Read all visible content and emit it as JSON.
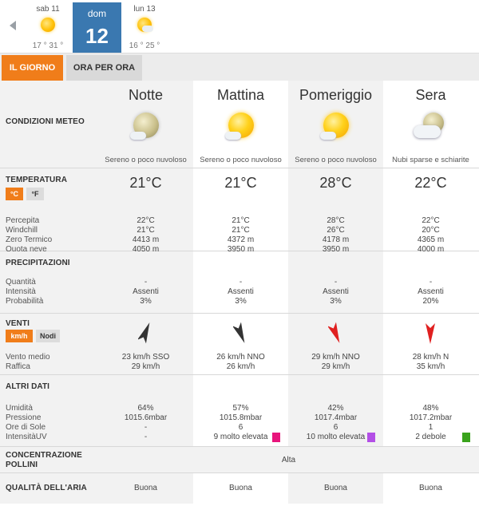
{
  "days": [
    {
      "name": "sab 11",
      "temps": "17 ° 31 °"
    },
    {
      "name": "dom",
      "number": "12"
    },
    {
      "name": "lun 13",
      "temps": "16 ° 25 °"
    }
  ],
  "tabs": {
    "day": "IL GIORNO",
    "hourly": "ORA PER ORA"
  },
  "labels": {
    "conditions": "CONDIZIONI METEO",
    "temperature": "TEMPERATURA",
    "celsius": "°C",
    "fahrenheit": "°F",
    "perceived": "Percepita",
    "windchill": "Windchill",
    "zero_termico": "Zero Termico",
    "quota_neve": "Quota neve",
    "precipitation": "PRECIPITAZIONI",
    "quantity": "Quantità",
    "intensity": "Intensità",
    "probability": "Probabilità",
    "wind": "VENTI",
    "kmh": "km/h",
    "knots": "Nodi",
    "avg_wind": "Vento medio",
    "gust": "Raffica",
    "other": "ALTRI DATI",
    "humidity": "Umidità",
    "pressure": "Pressione",
    "sun_hours": "Ore di Sole",
    "uv": "IntensitàUV",
    "pollen_1": "CONCENTRAZIONE",
    "pollen_2": "POLLINI",
    "pollen_value": "Alta",
    "air": "QUALITÀ DELL'ARIA"
  },
  "periods": [
    {
      "name": "Notte",
      "icon": "moon-cloud-icon",
      "condition": "Sereno o poco nuvoloso",
      "temp": "21°C",
      "perceived": "22°C",
      "windchill": "21°C",
      "zero": "4413 m",
      "snow": "4050 m",
      "quantity": "-",
      "intensity": "Assenti",
      "probability": "3%",
      "wind_dir": "SSO",
      "wind_avg": "23 km/h  SSO",
      "gust": "29 km/h",
      "arrow_color": "#333333",
      "humidity": "64%",
      "pressure": "1015.6mbar",
      "sun_hours": "-",
      "uv": "-",
      "uv_color": "",
      "air": "Buona"
    },
    {
      "name": "Mattina",
      "icon": "sun-cloud-icon",
      "condition": "Sereno o poco nuvoloso",
      "temp": "21°C",
      "perceived": "21°C",
      "windchill": "21°C",
      "zero": "4372 m",
      "snow": "3950 m",
      "quantity": "-",
      "intensity": "Assenti",
      "probability": "3%",
      "wind_dir": "NNO",
      "wind_avg": "26 km/h NNO",
      "gust": "26 km/h",
      "arrow_color": "#333333",
      "humidity": "57%",
      "pressure": "1015.8mbar",
      "sun_hours": "6",
      "uv": "9 molto elevata",
      "uv_color": "#e8157c",
      "air": "Buona"
    },
    {
      "name": "Pomeriggio",
      "icon": "sun-cloud-icon",
      "condition": "Sereno o poco nuvoloso",
      "temp": "28°C",
      "perceived": "28°C",
      "windchill": "26°C",
      "zero": "4178 m",
      "snow": "3950 m",
      "quantity": "-",
      "intensity": "Assenti",
      "probability": "3%",
      "wind_dir": "NNO",
      "wind_avg": "29 km/h NNO",
      "gust": "29 km/h",
      "arrow_color": "#e02020",
      "humidity": "42%",
      "pressure": "1017.4mbar",
      "sun_hours": "6",
      "uv": "10 molto elevata",
      "uv_color": "#b34fe6",
      "air": "Buona"
    },
    {
      "name": "Sera",
      "icon": "partly-cloudy-icon",
      "condition": "Nubi sparse e schiarite",
      "temp": "22°C",
      "perceived": "22°C",
      "windchill": "20°C",
      "zero": "4365 m",
      "snow": "4000 m",
      "quantity": "-",
      "intensity": "Assenti",
      "probability": "20%",
      "wind_dir": "N",
      "wind_avg": "28 km/h N",
      "gust": "35 km/h",
      "arrow_color": "#e02020",
      "humidity": "48%",
      "pressure": "1017.2mbar",
      "sun_hours": "1",
      "uv": "2 debole",
      "uv_color": "#3aa31c",
      "air": "Buona"
    }
  ]
}
